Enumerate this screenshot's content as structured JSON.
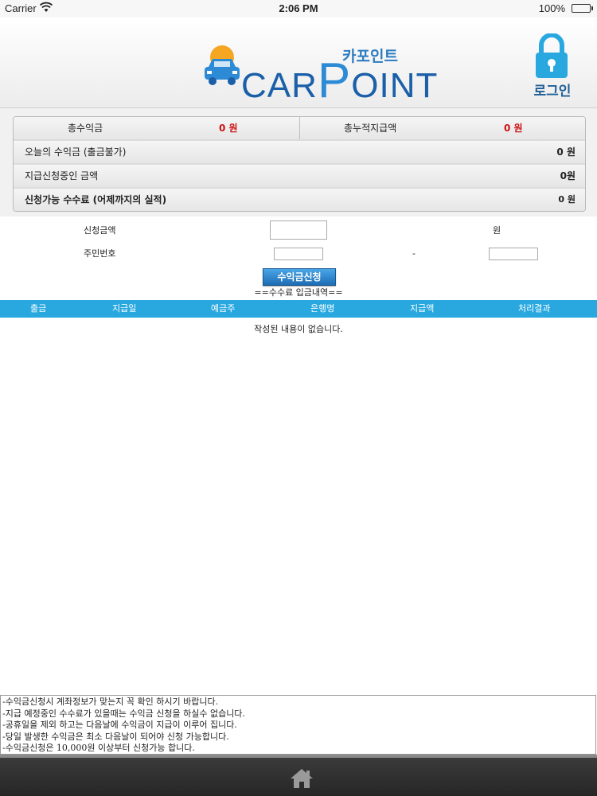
{
  "status_bar": {
    "carrier": "Carrier",
    "time": "2:06 PM",
    "battery": "100%"
  },
  "header": {
    "logo_korean": "카포인트",
    "logo_brand_1": "CAR",
    "logo_brand_p": "P",
    "logo_brand_2": "OINT",
    "login_label": "로그인"
  },
  "summary": {
    "total_income_label": "총수익금",
    "total_income_value": "0 원",
    "total_paid_label": "총누적지급액",
    "total_paid_value": "0 원",
    "rows": [
      {
        "label": "오늘의 수익금 (출금불가)",
        "value": "0 원"
      },
      {
        "label": "지급신청중인 금액",
        "value": "0원"
      },
      {
        "label": "신청가능 수수료 (어제까지의 실적)",
        "value": "0 원"
      }
    ]
  },
  "form": {
    "amount_label": "신청금액",
    "amount_value": "",
    "amount_unit": "원",
    "resident_label": "주민번호",
    "resident_front": "",
    "resident_sep": "-",
    "resident_back": "",
    "submit_label": "수익금신청"
  },
  "history": {
    "title": "==수수료 입금내역==",
    "columns": [
      "출금",
      "지급일",
      "예금주",
      "은행명",
      "지급액",
      "처리결과"
    ],
    "empty_message": "작성된 내용이 없습니다."
  },
  "notes": [
    "-수익금신청시 계좌정보가 맞는지 꼭 확인 하시기 바랍니다.",
    "-지급 예정중인 수수료가 있을때는 수익금 신청을 하실수 없습니다.",
    "-공휴일을 제외 하고는 다음날에 수익금이 지급이 이루어 집니다.",
    "-당일 발생한 수익금은 최소 다음날이 되어야 신청 가능합니다.",
    "-수익금신청은 10,000원 이상부터 신청가능 합니다."
  ],
  "colors": {
    "accent": "#29a8e0",
    "brand": "#1a5fa8",
    "negative": "#cc1111"
  },
  "icons": {
    "home": "home-icon",
    "lock": "lock-icon",
    "wifi": "wifi-icon"
  }
}
